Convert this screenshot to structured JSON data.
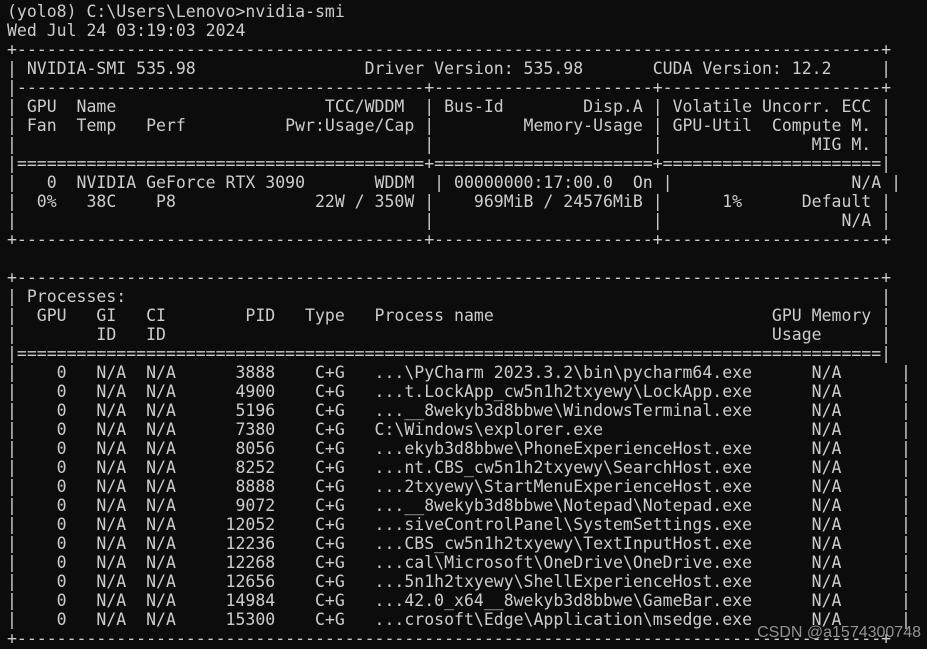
{
  "terminal": {
    "command": "(yolo8) C:\\Users\\Lenovo>nvidia-smi",
    "date": "Wed Jul 24 03:19:03 2024",
    "gpu_table": [
      "+---------------------------------------------------------------------------------------+",
      "| NVIDIA-SMI 535.98                 Driver Version: 535.98       CUDA Version: 12.2     |",
      "|-----------------------------------------+----------------------+----------------------+",
      "| GPU  Name                     TCC/WDDM  | Bus-Id        Disp.A | Volatile Uncorr. ECC |",
      "| Fan  Temp   Perf          Pwr:Usage/Cap |         Memory-Usage | GPU-Util  Compute M. |",
      "|                                         |                      |               MIG M. |",
      "|=========================================+======================+======================|",
      "|   0  NVIDIA GeForce RTX 3090       WDDM  | 00000000:17:00.0  On |                  N/A |",
      "|  0%   38C    P8              22W / 350W |    969MiB / 24576MiB |      1%      Default |",
      "|                                         |                      |                  N/A |",
      "+-----------------------------------------+----------------------+----------------------+"
    ],
    "blank": "",
    "process_header": [
      "+---------------------------------------------------------------------------------------+",
      "| Processes:                                                                            |",
      "|  GPU   GI   CI        PID   Type   Process name                            GPU Memory |",
      "|        ID   ID                                                             Usage      |",
      "|=======================================================================================|"
    ],
    "process_rows": [
      "|    0   N/A  N/A      3888    C+G   ...\\PyCharm 2023.3.2\\bin\\pycharm64.exe      N/A      |",
      "|    0   N/A  N/A      4900    C+G   ...t.LockApp_cw5n1h2txyewy\\LockApp.exe      N/A      |",
      "|    0   N/A  N/A      5196    C+G   ...__8wekyb3d8bbwe\\WindowsTerminal.exe      N/A      |",
      "|    0   N/A  N/A      7380    C+G   C:\\Windows\\explorer.exe                     N/A      |",
      "|    0   N/A  N/A      8056    C+G   ...ekyb3d8bbwe\\PhoneExperienceHost.exe      N/A      |",
      "|    0   N/A  N/A      8252    C+G   ...nt.CBS_cw5n1h2txyewy\\SearchHost.exe      N/A      |",
      "|    0   N/A  N/A      8888    C+G   ...2txyewy\\StartMenuExperienceHost.exe      N/A      |",
      "|    0   N/A  N/A      9072    C+G   ...__8wekyb3d8bbwe\\Notepad\\Notepad.exe      N/A      |",
      "|    0   N/A  N/A     12052    C+G   ...siveControlPanel\\SystemSettings.exe      N/A      |",
      "|    0   N/A  N/A     12236    C+G   ...CBS_cw5n1h2txyewy\\TextInputHost.exe      N/A      |",
      "|    0   N/A  N/A     12268    C+G   ...cal\\Microsoft\\OneDrive\\OneDrive.exe      N/A      |",
      "|    0   N/A  N/A     12656    C+G   ...5n1h2txyewy\\ShellExperienceHost.exe      N/A      |",
      "|    0   N/A  N/A     14984    C+G   ...42.0_x64__8wekyb3d8bbwe\\GameBar.exe      N/A      |",
      "|    0   N/A  N/A     15300    C+G   ...crosoft\\Edge\\Application\\msedge.exe      N/A      |"
    ],
    "process_footer": "+---------------------------------------------------------------------------------------+"
  },
  "watermark": "CSDN @a1574300748",
  "colors": {
    "background": "#0c0c0c",
    "foreground": "#cccccc"
  }
}
